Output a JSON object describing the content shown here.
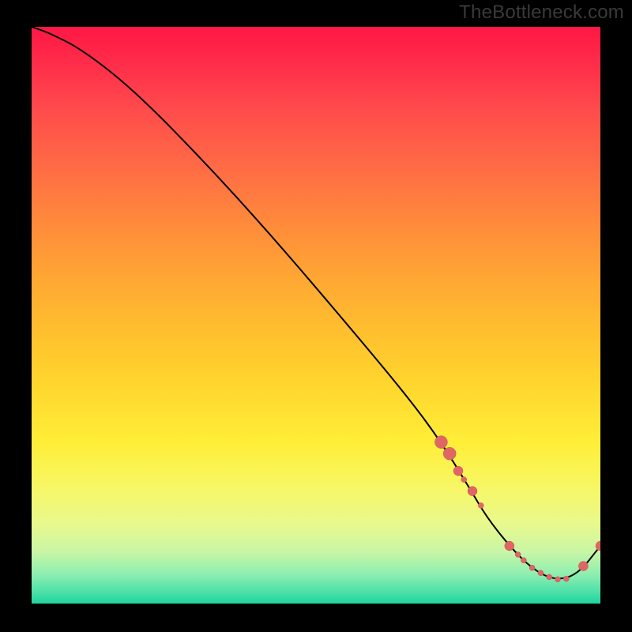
{
  "watermark": "TheBottleneck.com",
  "chart_data": {
    "type": "line",
    "title": "",
    "xlabel": "",
    "ylabel": "",
    "xlim": [
      0,
      100
    ],
    "ylim": [
      0,
      100
    ],
    "grid": false,
    "legend": false,
    "curve": {
      "x": [
        0,
        3,
        9,
        18,
        30,
        42,
        55,
        66,
        72,
        77,
        80,
        84,
        88,
        92,
        96,
        100
      ],
      "y": [
        100,
        99,
        96,
        89,
        77,
        64,
        49,
        36,
        28,
        20,
        15,
        10,
        6,
        4,
        5,
        10
      ]
    },
    "points": [
      {
        "x": 72,
        "y": 28,
        "size": "big"
      },
      {
        "x": 73.5,
        "y": 26,
        "size": "big"
      },
      {
        "x": 75,
        "y": 23,
        "size": "med"
      },
      {
        "x": 76,
        "y": 21.5,
        "size": "small"
      },
      {
        "x": 77.5,
        "y": 19.5,
        "size": "med"
      },
      {
        "x": 79,
        "y": 17,
        "size": "small"
      },
      {
        "x": 84,
        "y": 10,
        "size": "med"
      },
      {
        "x": 85.5,
        "y": 8.5,
        "size": "small"
      },
      {
        "x": 86.5,
        "y": 7.5,
        "size": "small"
      },
      {
        "x": 88,
        "y": 6.2,
        "size": "small"
      },
      {
        "x": 89.5,
        "y": 5.3,
        "size": "small"
      },
      {
        "x": 91,
        "y": 4.6,
        "size": "small"
      },
      {
        "x": 92.5,
        "y": 4.2,
        "size": "small"
      },
      {
        "x": 94,
        "y": 4.3,
        "size": "small"
      },
      {
        "x": 97,
        "y": 6.5,
        "size": "med"
      },
      {
        "x": 100,
        "y": 10,
        "size": "med"
      }
    ],
    "gradient_stops": [
      {
        "pos": 0,
        "color": "#ff1744"
      },
      {
        "pos": 7,
        "color": "#ff2f4a"
      },
      {
        "pos": 14,
        "color": "#ff4a4c"
      },
      {
        "pos": 24,
        "color": "#ff6a45"
      },
      {
        "pos": 34,
        "color": "#ff8a3b"
      },
      {
        "pos": 44,
        "color": "#ffa833"
      },
      {
        "pos": 54,
        "color": "#ffc22e"
      },
      {
        "pos": 63,
        "color": "#ffd82e"
      },
      {
        "pos": 72,
        "color": "#ffee38"
      },
      {
        "pos": 80,
        "color": "#f7f766"
      },
      {
        "pos": 86,
        "color": "#e9f98c"
      },
      {
        "pos": 91,
        "color": "#c9f6a6"
      },
      {
        "pos": 95,
        "color": "#8ceeb0"
      },
      {
        "pos": 98,
        "color": "#4de0a9"
      },
      {
        "pos": 100,
        "color": "#1fd39e"
      }
    ]
  }
}
